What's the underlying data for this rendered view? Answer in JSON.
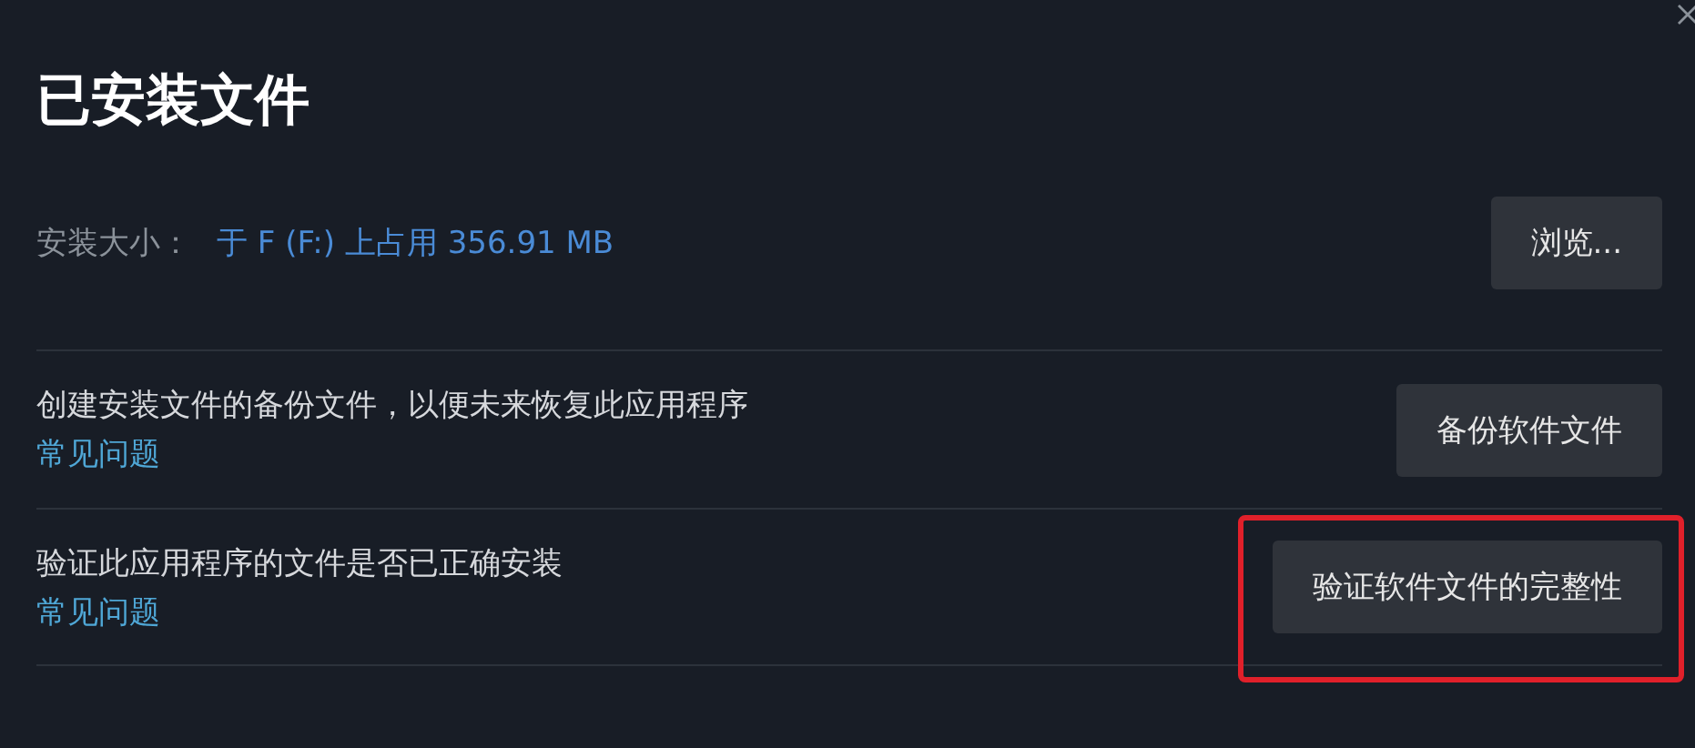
{
  "dialog": {
    "title": "已安装文件"
  },
  "install_size": {
    "label": "安装大小：",
    "value": "于 F (F:) 上占用 356.91 MB",
    "button": "浏览..."
  },
  "rows": [
    {
      "description": "创建安装文件的备份文件，以便未来恢复此应用程序",
      "link": "常见问题",
      "button": "备份软件文件",
      "highlighted": false
    },
    {
      "description": "验证此应用程序的文件是否已正确安装",
      "link": "常见问题",
      "button": "验证软件文件的完整性",
      "highlighted": true
    }
  ]
}
